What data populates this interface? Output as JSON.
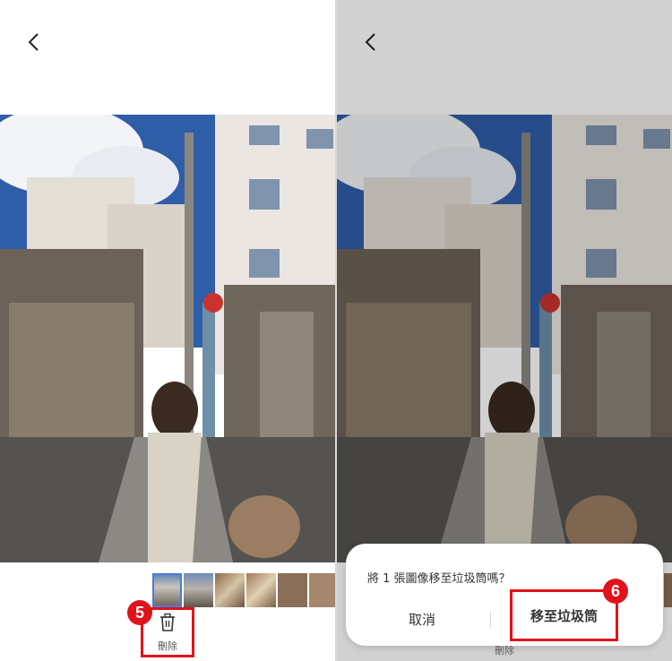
{
  "left_panel": {
    "delete_label": "刪除",
    "step_badge": "5"
  },
  "right_panel": {
    "dialog": {
      "message": "將 1 張圖像移至垃圾筒嗎？",
      "cancel_label": "取消",
      "confirm_label": "移至垃圾筒"
    },
    "step_badge": "6",
    "under_label": "刪除"
  },
  "colors": {
    "highlight": "#e0121b",
    "accent": "#4d7ad6"
  },
  "icons": [
    "back-arrow-icon",
    "trash-icon"
  ]
}
